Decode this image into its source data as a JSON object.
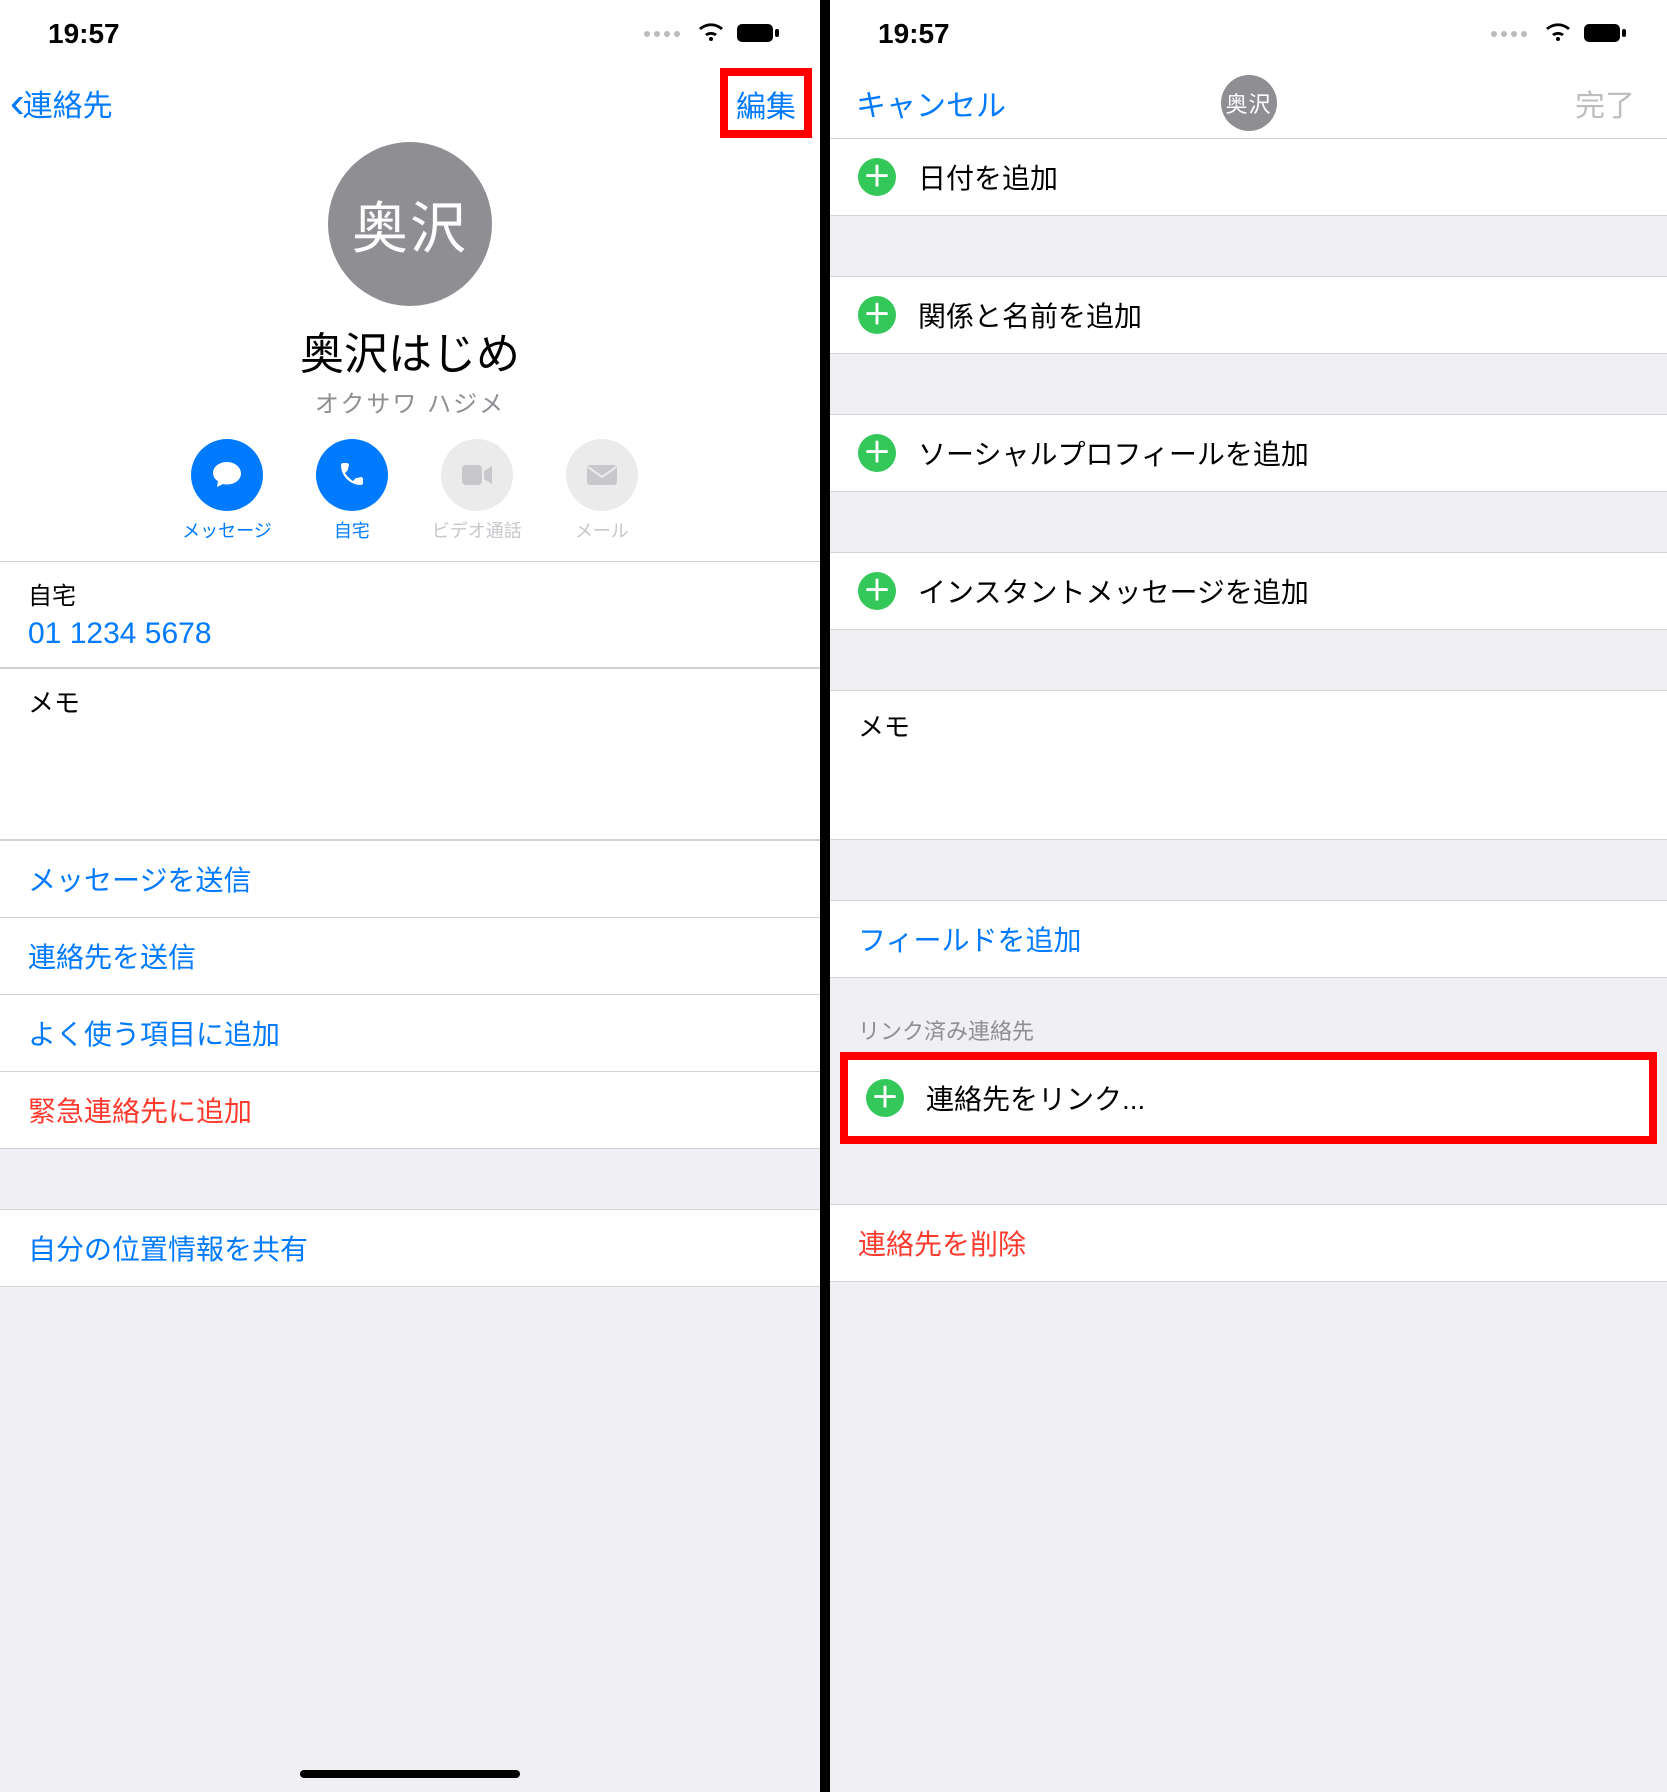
{
  "status": {
    "time": "19:57"
  },
  "left": {
    "nav": {
      "back": "連絡先",
      "edit": "編集"
    },
    "profile": {
      "initials": "奥沢",
      "name": "奥沢はじめ",
      "furigana": "オクサワ ハジメ"
    },
    "actions": {
      "message": "メッセージ",
      "call": "自宅",
      "video": "ビデオ通話",
      "mail": "メール"
    },
    "phone": {
      "label": "自宅",
      "number": "01 1234 5678"
    },
    "memo_label": "メモ",
    "links": {
      "send_message": "メッセージを送信",
      "share_contact": "連絡先を送信",
      "add_favorite": "よく使う項目に追加",
      "add_emergency": "緊急連絡先に追加",
      "share_location": "自分の位置情報を共有"
    }
  },
  "right": {
    "nav": {
      "cancel": "キャンセル",
      "done": "完了",
      "initials": "奥沢"
    },
    "add_date": "日付を追加",
    "add_relation": "関係と名前を追加",
    "add_social": "ソーシャルプロフィールを追加",
    "add_im": "インスタントメッセージを追加",
    "memo_label": "メモ",
    "add_field": "フィールドを追加",
    "linked_label": "リンク済み連絡先",
    "link_contact": "連絡先をリンク...",
    "delete_contact": "連絡先を削除"
  }
}
